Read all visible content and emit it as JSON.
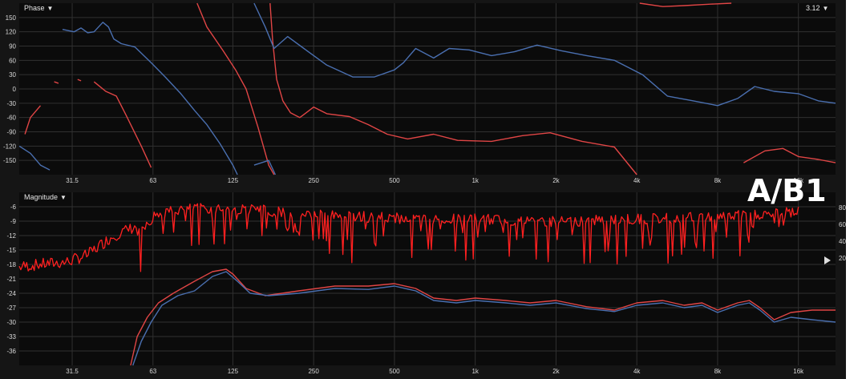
{
  "phase_panel": {
    "menu_label": "Phase",
    "menu_arrow": "▼",
    "readout": "3.12",
    "readout_arrow": "▼"
  },
  "magnitude_panel": {
    "menu_label": "Magnitude",
    "menu_arrow": "▼",
    "marker_value": "20"
  },
  "watermark": "A/B1",
  "colors": {
    "background": "#151515",
    "plot_bg": "#0b0b0b",
    "grid": "#303030",
    "trace_red": "#e04545",
    "trace_red_bright": "#ff2020",
    "trace_blue": "#4a6fb0",
    "text": "#d8d8d8"
  },
  "chart_data": [
    {
      "type": "line",
      "title": "Phase",
      "x_scale": "log",
      "xlim": [
        20,
        22000
      ],
      "ylim": [
        -180,
        180
      ],
      "x_ticks": [
        {
          "value": 31.5,
          "label": "31.5"
        },
        {
          "value": 63,
          "label": "63"
        },
        {
          "value": 125,
          "label": "125"
        },
        {
          "value": 250,
          "label": "250"
        },
        {
          "value": 500,
          "label": "500"
        },
        {
          "value": 1000,
          "label": "1k"
        },
        {
          "value": 2000,
          "label": "2k"
        },
        {
          "value": 4000,
          "label": "4k"
        },
        {
          "value": 8000,
          "label": "8k"
        },
        {
          "value": 16000,
          "label": "16k"
        }
      ],
      "y_ticks": [
        150,
        120,
        90,
        60,
        30,
        0,
        -30,
        -60,
        -90,
        -120,
        -150
      ],
      "grid": true,
      "series": [
        {
          "color": "red",
          "segments": [
            [
              [
                21,
                -95
              ],
              [
                22,
                -60
              ],
              [
                24,
                -35
              ]
            ],
            [
              [
                27,
                15
              ],
              [
                28,
                12
              ]
            ],
            [
              [
                33,
                20
              ],
              [
                34,
                17
              ]
            ],
            [
              [
                38,
                15
              ],
              [
                42,
                -5
              ],
              [
                46,
                -15
              ],
              [
                50,
                -55
              ],
              [
                57,
                -120
              ],
              [
                62,
                -165
              ]
            ],
            [
              [
                92,
                180
              ],
              [
                100,
                130
              ],
              [
                115,
                80
              ],
              [
                128,
                40
              ],
              [
                140,
                0
              ],
              [
                155,
                -80
              ],
              [
                170,
                -160
              ],
              [
                178,
                -180
              ]
            ],
            [
              [
                172,
                180
              ],
              [
                176,
                100
              ],
              [
                182,
                20
              ],
              [
                192,
                -25
              ],
              [
                205,
                -50
              ],
              [
                222,
                -60
              ],
              [
                250,
                -38
              ],
              [
                280,
                -52
              ],
              [
                340,
                -58
              ],
              [
                400,
                -75
              ],
              [
                470,
                -95
              ],
              [
                560,
                -105
              ],
              [
                700,
                -95
              ],
              [
                860,
                -108
              ],
              [
                1150,
                -110
              ],
              [
                1500,
                -98
              ],
              [
                1900,
                -92
              ],
              [
                2500,
                -110
              ],
              [
                3300,
                -122
              ],
              [
                4000,
                -180
              ]
            ],
            [
              [
                4100,
                180
              ],
              [
                5000,
                173
              ],
              [
                6000,
                175
              ],
              [
                7500,
                178
              ],
              [
                9000,
                180
              ]
            ],
            [
              [
                10000,
                -155
              ],
              [
                12000,
                -130
              ],
              [
                14000,
                -125
              ],
              [
                16000,
                -142
              ],
              [
                19000,
                -148
              ],
              [
                22000,
                -155
              ]
            ]
          ]
        },
        {
          "color": "blue",
          "segments": [
            [
              [
                29,
                125
              ],
              [
                32,
                120
              ],
              [
                34,
                128
              ],
              [
                36,
                118
              ],
              [
                38,
                120
              ],
              [
                41,
                140
              ],
              [
                43,
                130
              ],
              [
                45,
                105
              ],
              [
                48,
                95
              ],
              [
                54,
                88
              ],
              [
                62,
                55
              ],
              [
                70,
                25
              ],
              [
                80,
                -10
              ],
              [
                90,
                -45
              ],
              [
                100,
                -75
              ],
              [
                112,
                -115
              ],
              [
                125,
                -160
              ],
              [
                130,
                -180
              ]
            ],
            [
              [
                150,
                180
              ],
              [
                165,
                130
              ],
              [
                178,
                85
              ],
              [
                200,
                110
              ],
              [
                230,
                85
              ],
              [
                280,
                50
              ],
              [
                350,
                25
              ],
              [
                420,
                25
              ],
              [
                500,
                40
              ],
              [
                540,
                55
              ],
              [
                600,
                85
              ],
              [
                700,
                65
              ],
              [
                800,
                85
              ],
              [
                950,
                82
              ],
              [
                1150,
                70
              ],
              [
                1400,
                78
              ],
              [
                1700,
                92
              ],
              [
                2100,
                80
              ],
              [
                2600,
                70
              ],
              [
                3300,
                60
              ],
              [
                4200,
                30
              ],
              [
                5200,
                -15
              ],
              [
                6500,
                -25
              ],
              [
                8000,
                -35
              ],
              [
                9500,
                -20
              ],
              [
                11000,
                5
              ],
              [
                13000,
                -5
              ],
              [
                16000,
                -10
              ],
              [
                19000,
                -25
              ],
              [
                22000,
                -30
              ]
            ],
            [
              [
                20,
                -120
              ],
              [
                22,
                -135
              ],
              [
                24,
                -160
              ],
              [
                26,
                -170
              ]
            ],
            [
              [
                150,
                -160
              ],
              [
                170,
                -150
              ],
              [
                180,
                -180
              ]
            ]
          ]
        }
      ]
    },
    {
      "type": "line",
      "title": "Magnitude",
      "x_scale": "log",
      "xlim": [
        20,
        22000
      ],
      "ylim": [
        -39,
        -3
      ],
      "y2_ticks": [
        80,
        60,
        40,
        20
      ],
      "x_ticks": [
        {
          "value": 31.5,
          "label": "31.5"
        },
        {
          "value": 63,
          "label": "63"
        },
        {
          "value": 125,
          "label": "125"
        },
        {
          "value": 250,
          "label": "250"
        },
        {
          "value": 500,
          "label": "500"
        },
        {
          "value": 1000,
          "label": "1k"
        },
        {
          "value": 2000,
          "label": "2k"
        },
        {
          "value": 4000,
          "label": "4k"
        },
        {
          "value": 8000,
          "label": "8k"
        },
        {
          "value": 16000,
          "label": "16k"
        }
      ],
      "y_ticks": [
        -6,
        -9,
        -12,
        -15,
        -18,
        -21,
        -24,
        -27,
        -30,
        -33,
        -36
      ],
      "grid": true,
      "series": [
        {
          "color": "red-bright",
          "noisy": true,
          "points": [
            [
              20,
              -18.5
            ],
            [
              24,
              -18
            ],
            [
              30,
              -17.5
            ],
            [
              36,
              -16
            ],
            [
              40,
              -14
            ],
            [
              45,
              -12
            ],
            [
              55,
              -10
            ],
            [
              65,
              -6.5
            ],
            [
              80,
              -5.5
            ],
            [
              100,
              -5.2
            ],
            [
              150,
              -5.5
            ],
            [
              250,
              -6.5
            ],
            [
              400,
              -7
            ],
            [
              600,
              -7.5
            ],
            [
              1000,
              -7.5
            ],
            [
              2000,
              -8
            ],
            [
              4000,
              -7.5
            ],
            [
              8000,
              -7
            ],
            [
              12000,
              -6.5
            ],
            [
              16000,
              -6
            ]
          ]
        },
        {
          "color": "red",
          "points": [
            [
              52,
              -39
            ],
            [
              55,
              -33
            ],
            [
              60,
              -29
            ],
            [
              66,
              -26
            ],
            [
              75,
              -24
            ],
            [
              90,
              -21.5
            ],
            [
              105,
              -19.5
            ],
            [
              118,
              -19
            ],
            [
              125,
              -20
            ],
            [
              140,
              -23
            ],
            [
              165,
              -24.5
            ],
            [
              220,
              -23.5
            ],
            [
              300,
              -22.5
            ],
            [
              400,
              -22.5
            ],
            [
              500,
              -22
            ],
            [
              600,
              -23
            ],
            [
              700,
              -25
            ],
            [
              850,
              -25.5
            ],
            [
              1000,
              -25
            ],
            [
              1300,
              -25.5
            ],
            [
              1600,
              -26
            ],
            [
              2000,
              -25.5
            ],
            [
              2600,
              -26.8
            ],
            [
              3300,
              -27.5
            ],
            [
              4000,
              -26
            ],
            [
              5000,
              -25.5
            ],
            [
              6000,
              -26.5
            ],
            [
              7000,
              -26
            ],
            [
              8000,
              -27.5
            ],
            [
              9500,
              -26
            ],
            [
              10500,
              -25.5
            ],
            [
              11500,
              -27
            ],
            [
              13000,
              -29.5
            ],
            [
              15000,
              -28
            ],
            [
              18000,
              -27.5
            ],
            [
              22000,
              -27.5
            ]
          ]
        },
        {
          "color": "blue",
          "points": [
            [
              53,
              -39
            ],
            [
              57,
              -34
            ],
            [
              62,
              -30
            ],
            [
              68,
              -26.5
            ],
            [
              78,
              -24.5
            ],
            [
              90,
              -23.5
            ],
            [
              105,
              -20.5
            ],
            [
              118,
              -19.5
            ],
            [
              130,
              -21.5
            ],
            [
              145,
              -24
            ],
            [
              170,
              -24.5
            ],
            [
              220,
              -24
            ],
            [
              300,
              -23
            ],
            [
              400,
              -23.2
            ],
            [
              500,
              -22.5
            ],
            [
              600,
              -23.5
            ],
            [
              700,
              -25.5
            ],
            [
              850,
              -26
            ],
            [
              1000,
              -25.5
            ],
            [
              1300,
              -26
            ],
            [
              1600,
              -26.5
            ],
            [
              2000,
              -26
            ],
            [
              2600,
              -27.2
            ],
            [
              3300,
              -27.8
            ],
            [
              4000,
              -26.5
            ],
            [
              5000,
              -26
            ],
            [
              6000,
              -27
            ],
            [
              7000,
              -26.5
            ],
            [
              8000,
              -28
            ],
            [
              9500,
              -26.5
            ],
            [
              10500,
              -26
            ],
            [
              11500,
              -27.5
            ],
            [
              13000,
              -30
            ],
            [
              15000,
              -29
            ],
            [
              18000,
              -29.5
            ],
            [
              22000,
              -30
            ]
          ]
        }
      ]
    }
  ]
}
